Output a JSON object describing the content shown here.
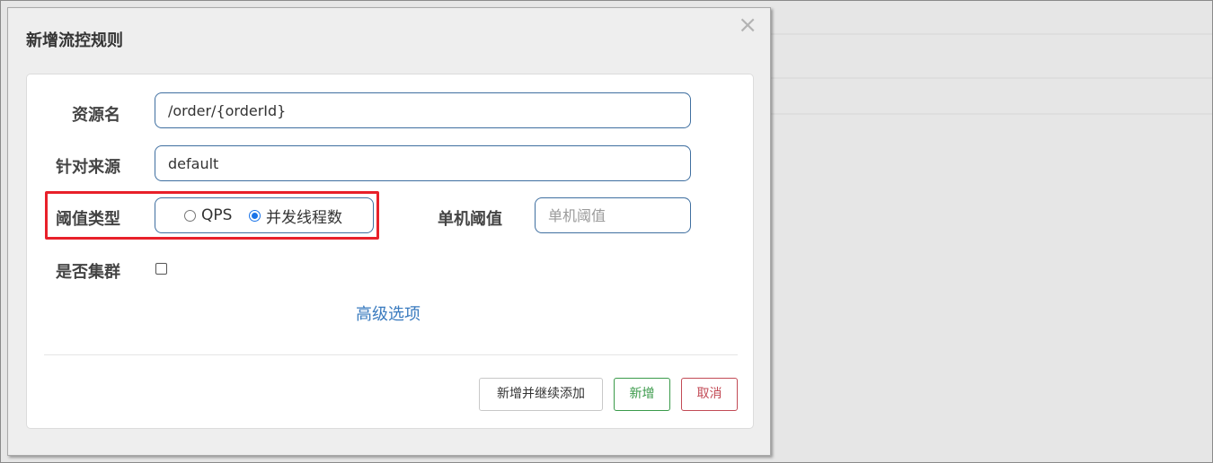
{
  "dialog": {
    "title": "新增流控规则",
    "close_symbol": "×"
  },
  "form": {
    "resource_label": "资源名",
    "resource_value": "/order/{orderId}",
    "source_label": "针对来源",
    "source_value": "default",
    "threshold_type_label": "阈值类型",
    "threshold_type_options": [
      "QPS",
      "并发线程数"
    ],
    "threshold_type_selected": "并发线程数",
    "single_threshold_label": "单机阈值",
    "single_threshold_placeholder": "单机阈值",
    "cluster_label": "是否集群",
    "cluster_checked": false,
    "advanced_link": "高级选项"
  },
  "buttons": {
    "add_continue": "新增并继续添加",
    "add": "新增",
    "cancel": "取消"
  },
  "colors": {
    "highlight": "#e8202a",
    "link": "#3a7bbf",
    "success": "#3a9a4a",
    "danger": "#c24a55",
    "input_border": "#3f6fa0"
  }
}
